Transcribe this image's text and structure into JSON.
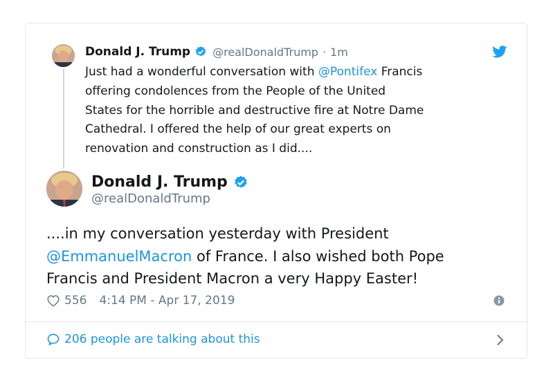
{
  "colors": {
    "accent": "#1b95e0",
    "text": "#14171a",
    "muted": "#657786",
    "border": "#e1e8ed"
  },
  "icons": {
    "brand": "twitter-bird-icon",
    "verified": "verified-badge-icon",
    "like": "heart-icon",
    "info": "info-icon",
    "reply": "speech-bubble-icon",
    "navigate": "chevron-right-icon"
  },
  "parent_tweet": {
    "author_name": "Donald J. Trump",
    "handle": "@realDonaldTrump",
    "separator": "·",
    "time": "1m",
    "lines": {
      "l1_before": "Just had a wonderful conversation with ",
      "l1_mention": "@Pontifex",
      "l1_after": " Francis",
      "l2": "offering condolences from the People of the United",
      "l3": "States for the horrible and destructive fire at Notre Dame",
      "l4": "Cathedral. I offered the help of our great experts on",
      "l5": "renovation and construction as I did...."
    }
  },
  "main_tweet": {
    "author_name": "Donald J. Trump",
    "handle": "@realDonaldTrump",
    "lines": {
      "l1": "....in my conversation yesterday with President",
      "l2_mention": "@EmmanuelMacron",
      "l2_after": " of France. I also wished both Pope",
      "l3": "Francis and President Macron a very Happy Easter!"
    },
    "likes": "556",
    "timestamp": "4:14 PM - Apr 17, 2019"
  },
  "footer": {
    "talking_label": "206 people are talking about this"
  }
}
